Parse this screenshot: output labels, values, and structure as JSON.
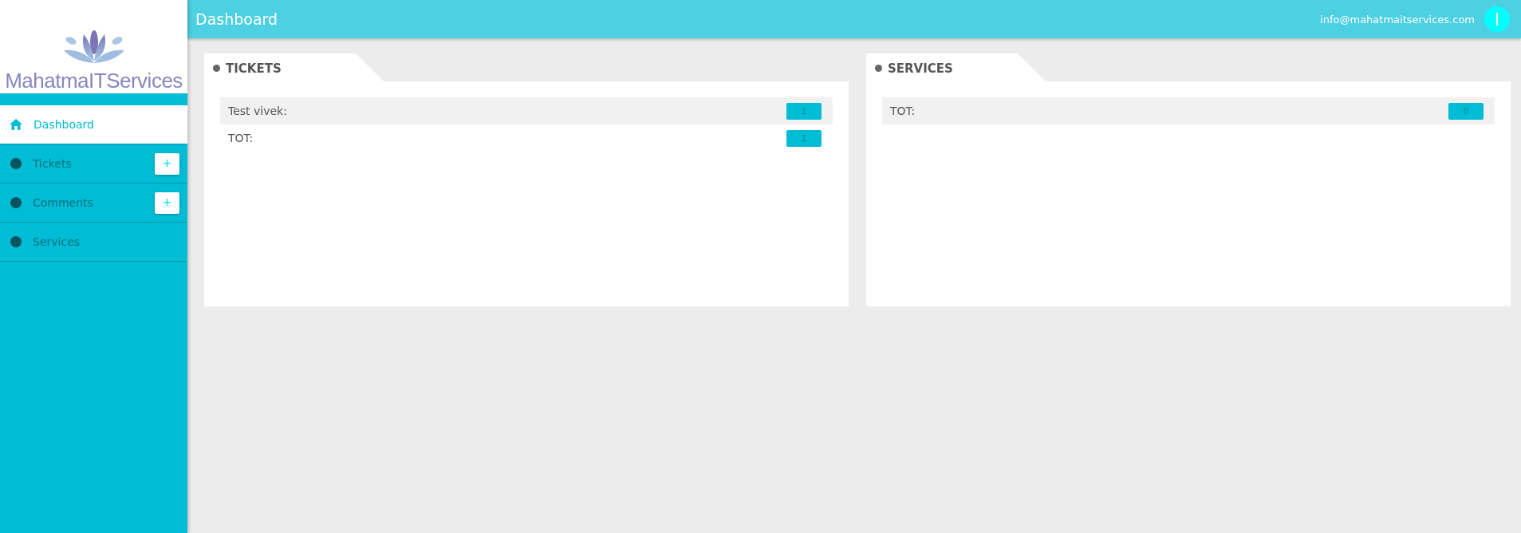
{
  "sidebar": {
    "logo_text": "MahatmaITServices",
    "items": [
      {
        "label": "Dashboard",
        "kind": "home",
        "selected": true
      },
      {
        "label": "Tickets",
        "kind": "dot",
        "selected": false,
        "add_button": "+"
      },
      {
        "label": "Comments",
        "kind": "dot",
        "selected": false,
        "add_button": "+"
      },
      {
        "label": "Services",
        "kind": "dot",
        "selected": false
      }
    ]
  },
  "header": {
    "title": "Dashboard",
    "email": "info@mahatmaitservices.com",
    "avatar_letter": "I"
  },
  "cards": [
    {
      "title": "TICKETS",
      "rows": [
        {
          "label": "Test vivek:",
          "count": "1"
        },
        {
          "label": "TOT:",
          "count": "1"
        }
      ]
    },
    {
      "title": "SERVICES",
      "rows": [
        {
          "label": "TOT:",
          "count": "0"
        }
      ]
    }
  ]
}
